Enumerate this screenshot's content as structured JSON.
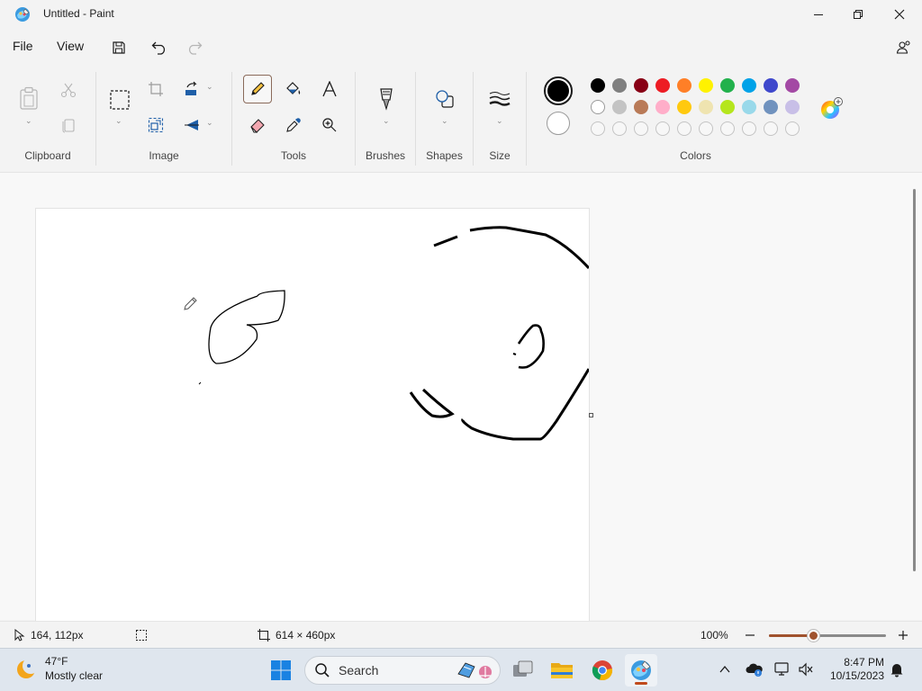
{
  "window": {
    "title": "Untitled - Paint",
    "controls": [
      "minimize",
      "maximize",
      "close"
    ]
  },
  "menu": {
    "file": "File",
    "view": "View",
    "quick_access": [
      "save-icon",
      "undo-icon",
      "redo-icon"
    ]
  },
  "ribbon": {
    "groups": {
      "clipboard": "Clipboard",
      "image": "Image",
      "tools": "Tools",
      "brushes": "Brushes",
      "shapes": "Shapes",
      "size": "Size",
      "colors": "Colors"
    },
    "active_tool": "pencil",
    "color1": "#000000",
    "color2": "#FFFFFF",
    "palette_row1": [
      "#000000",
      "#7F7F7F",
      "#880015",
      "#ED1C24",
      "#FF7F27",
      "#FFF200",
      "#22B14C",
      "#00A2E8",
      "#3F48CC",
      "#A349A4"
    ],
    "palette_row2": [
      "#FFFFFF",
      "#C3C3C3",
      "#B97A57",
      "#FFAEC9",
      "#FFC90E",
      "#EFE4B0",
      "#B5E61D",
      "#99D9EA",
      "#7092BE",
      "#C8BFE7"
    ],
    "palette_row3_custom_slots": 10
  },
  "status": {
    "cursor_position": "164, 112px",
    "canvas_size": "614 × 460px",
    "zoom": "100%",
    "zoom_level": 0.38
  },
  "taskbar": {
    "weather_temp": "47°F",
    "weather_desc": "Mostly clear",
    "search_label": "Search",
    "time": "8:47 PM",
    "date": "10/15/2023",
    "pinned_icons": [
      "start-icon",
      "search-icon",
      "task-view-icon",
      "file-explorer-icon",
      "chrome-icon",
      "paint-icon"
    ],
    "active_app": "paint-icon"
  }
}
